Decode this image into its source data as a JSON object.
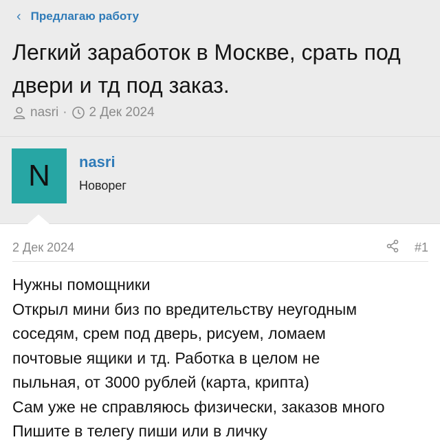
{
  "breadcrumb": {
    "label": "Предлагаю работу"
  },
  "thread": {
    "title": "Легкий заработок в Москве, срать под двери и тд под заказ.",
    "author": "nasri",
    "date": "2 Дек 2024"
  },
  "author_card": {
    "avatar_letter": "N",
    "avatar_color": "#27a6a4",
    "username": "nasri",
    "role": "Новорег"
  },
  "post": {
    "date": "2 Дек 2024",
    "number": "#1",
    "lines": [
      "Нужны помощники",
      "Открыл мини биз по вредительству неугодным",
      "соседям, срем под дверь, рисуем, ломаем",
      "почтовые ящики и тд. Работка в целом не",
      "пыльная, от 3000 рублей (карта, крипта)",
      "Сам уже не справляюсь физически, заказов много",
      "Пишите в телегу пиши или в личку"
    ]
  },
  "colors": {
    "accent": "#2f7bb8",
    "header_bg": "#ececec"
  },
  "icons": [
    "chevron-left-icon",
    "user-icon",
    "clock-icon",
    "share-icon"
  ]
}
